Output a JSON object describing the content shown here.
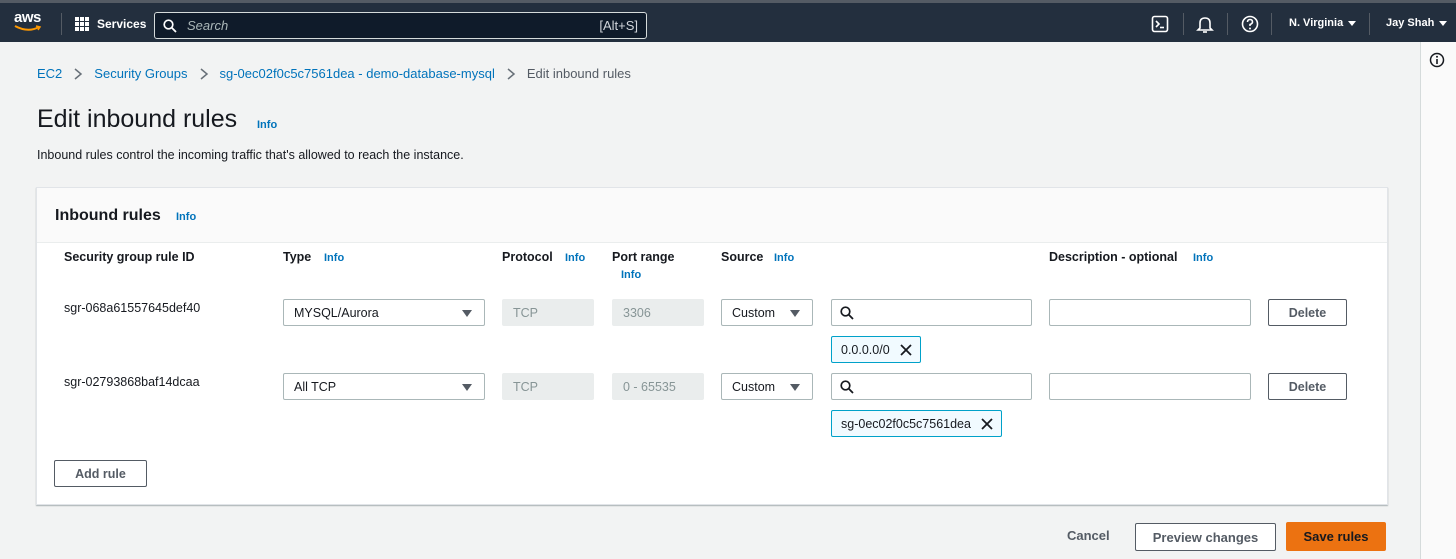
{
  "topbar": {
    "logo_text": "aws",
    "services_label": "Services",
    "search_placeholder": "Search",
    "search_shortcut": "[Alt+S]",
    "region": "N. Virginia",
    "user": "Jay Shah"
  },
  "breadcrumb": [
    "EC2",
    "Security Groups",
    "sg-0ec02f0c5c7561dea - demo-database-mysql",
    "Edit inbound rules"
  ],
  "page": {
    "title": "Edit inbound rules",
    "info": "Info",
    "description": "Inbound rules control the incoming traffic that's allowed to reach the instance."
  },
  "panel": {
    "title": "Inbound rules",
    "info": "Info",
    "columns": {
      "rule_id": "Security group rule ID",
      "type": "Type",
      "protocol": "Protocol",
      "port_range": "Port range",
      "source": "Source",
      "description": "Description - optional",
      "info": "Info"
    },
    "rules": [
      {
        "id": "sgr-068a61557645def40",
        "type": "MYSQL/Aurora",
        "protocol": "TCP",
        "port_range": "3306",
        "source": "Custom",
        "source_search": "",
        "token": "0.0.0.0/0",
        "description": "",
        "delete_label": "Delete"
      },
      {
        "id": "sgr-02793868baf14dcaa",
        "type": "All TCP",
        "protocol": "TCP",
        "port_range": "0 - 65535",
        "source": "Custom",
        "source_search": "",
        "token": "sg-0ec02f0c5c7561dea",
        "description": "",
        "delete_label": "Delete"
      }
    ],
    "add_rule_label": "Add rule"
  },
  "footer": {
    "cancel_label": "Cancel",
    "preview_label": "Preview changes",
    "save_label": "Save rules"
  },
  "colors": {
    "nav_bg": "#232f3e",
    "link": "#0073bb",
    "primary": "#ec7211",
    "token_border": "#00a1c9"
  }
}
